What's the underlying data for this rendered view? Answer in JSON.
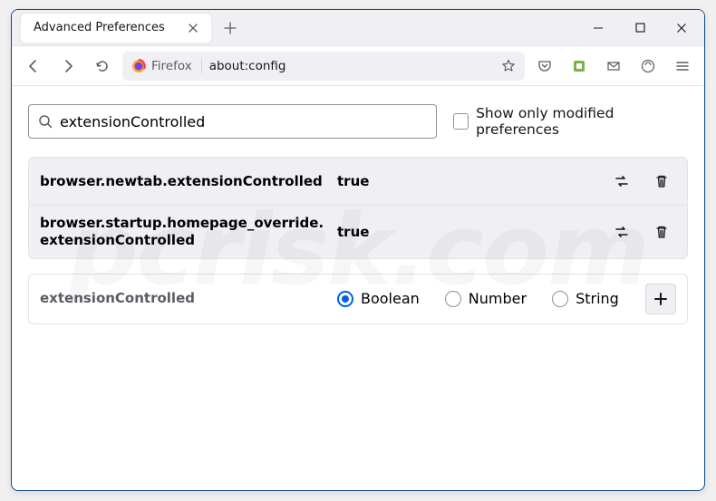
{
  "window": {
    "title": "Advanced Preferences"
  },
  "toolbar": {
    "identity_label": "Firefox",
    "url": "about:config"
  },
  "search": {
    "value": "extensionControlled",
    "checkbox_label": "Show only modified preferences",
    "checkbox_checked": false
  },
  "prefs": [
    {
      "name": "browser.newtab.extensionControlled",
      "value": "true",
      "modified": true
    },
    {
      "name": "browser.startup.homepage_override.extensionControlled",
      "value": "true",
      "modified": true
    }
  ],
  "new_pref": {
    "name": "extensionControlled",
    "types": [
      "Boolean",
      "Number",
      "String"
    ],
    "selected": "Boolean"
  }
}
